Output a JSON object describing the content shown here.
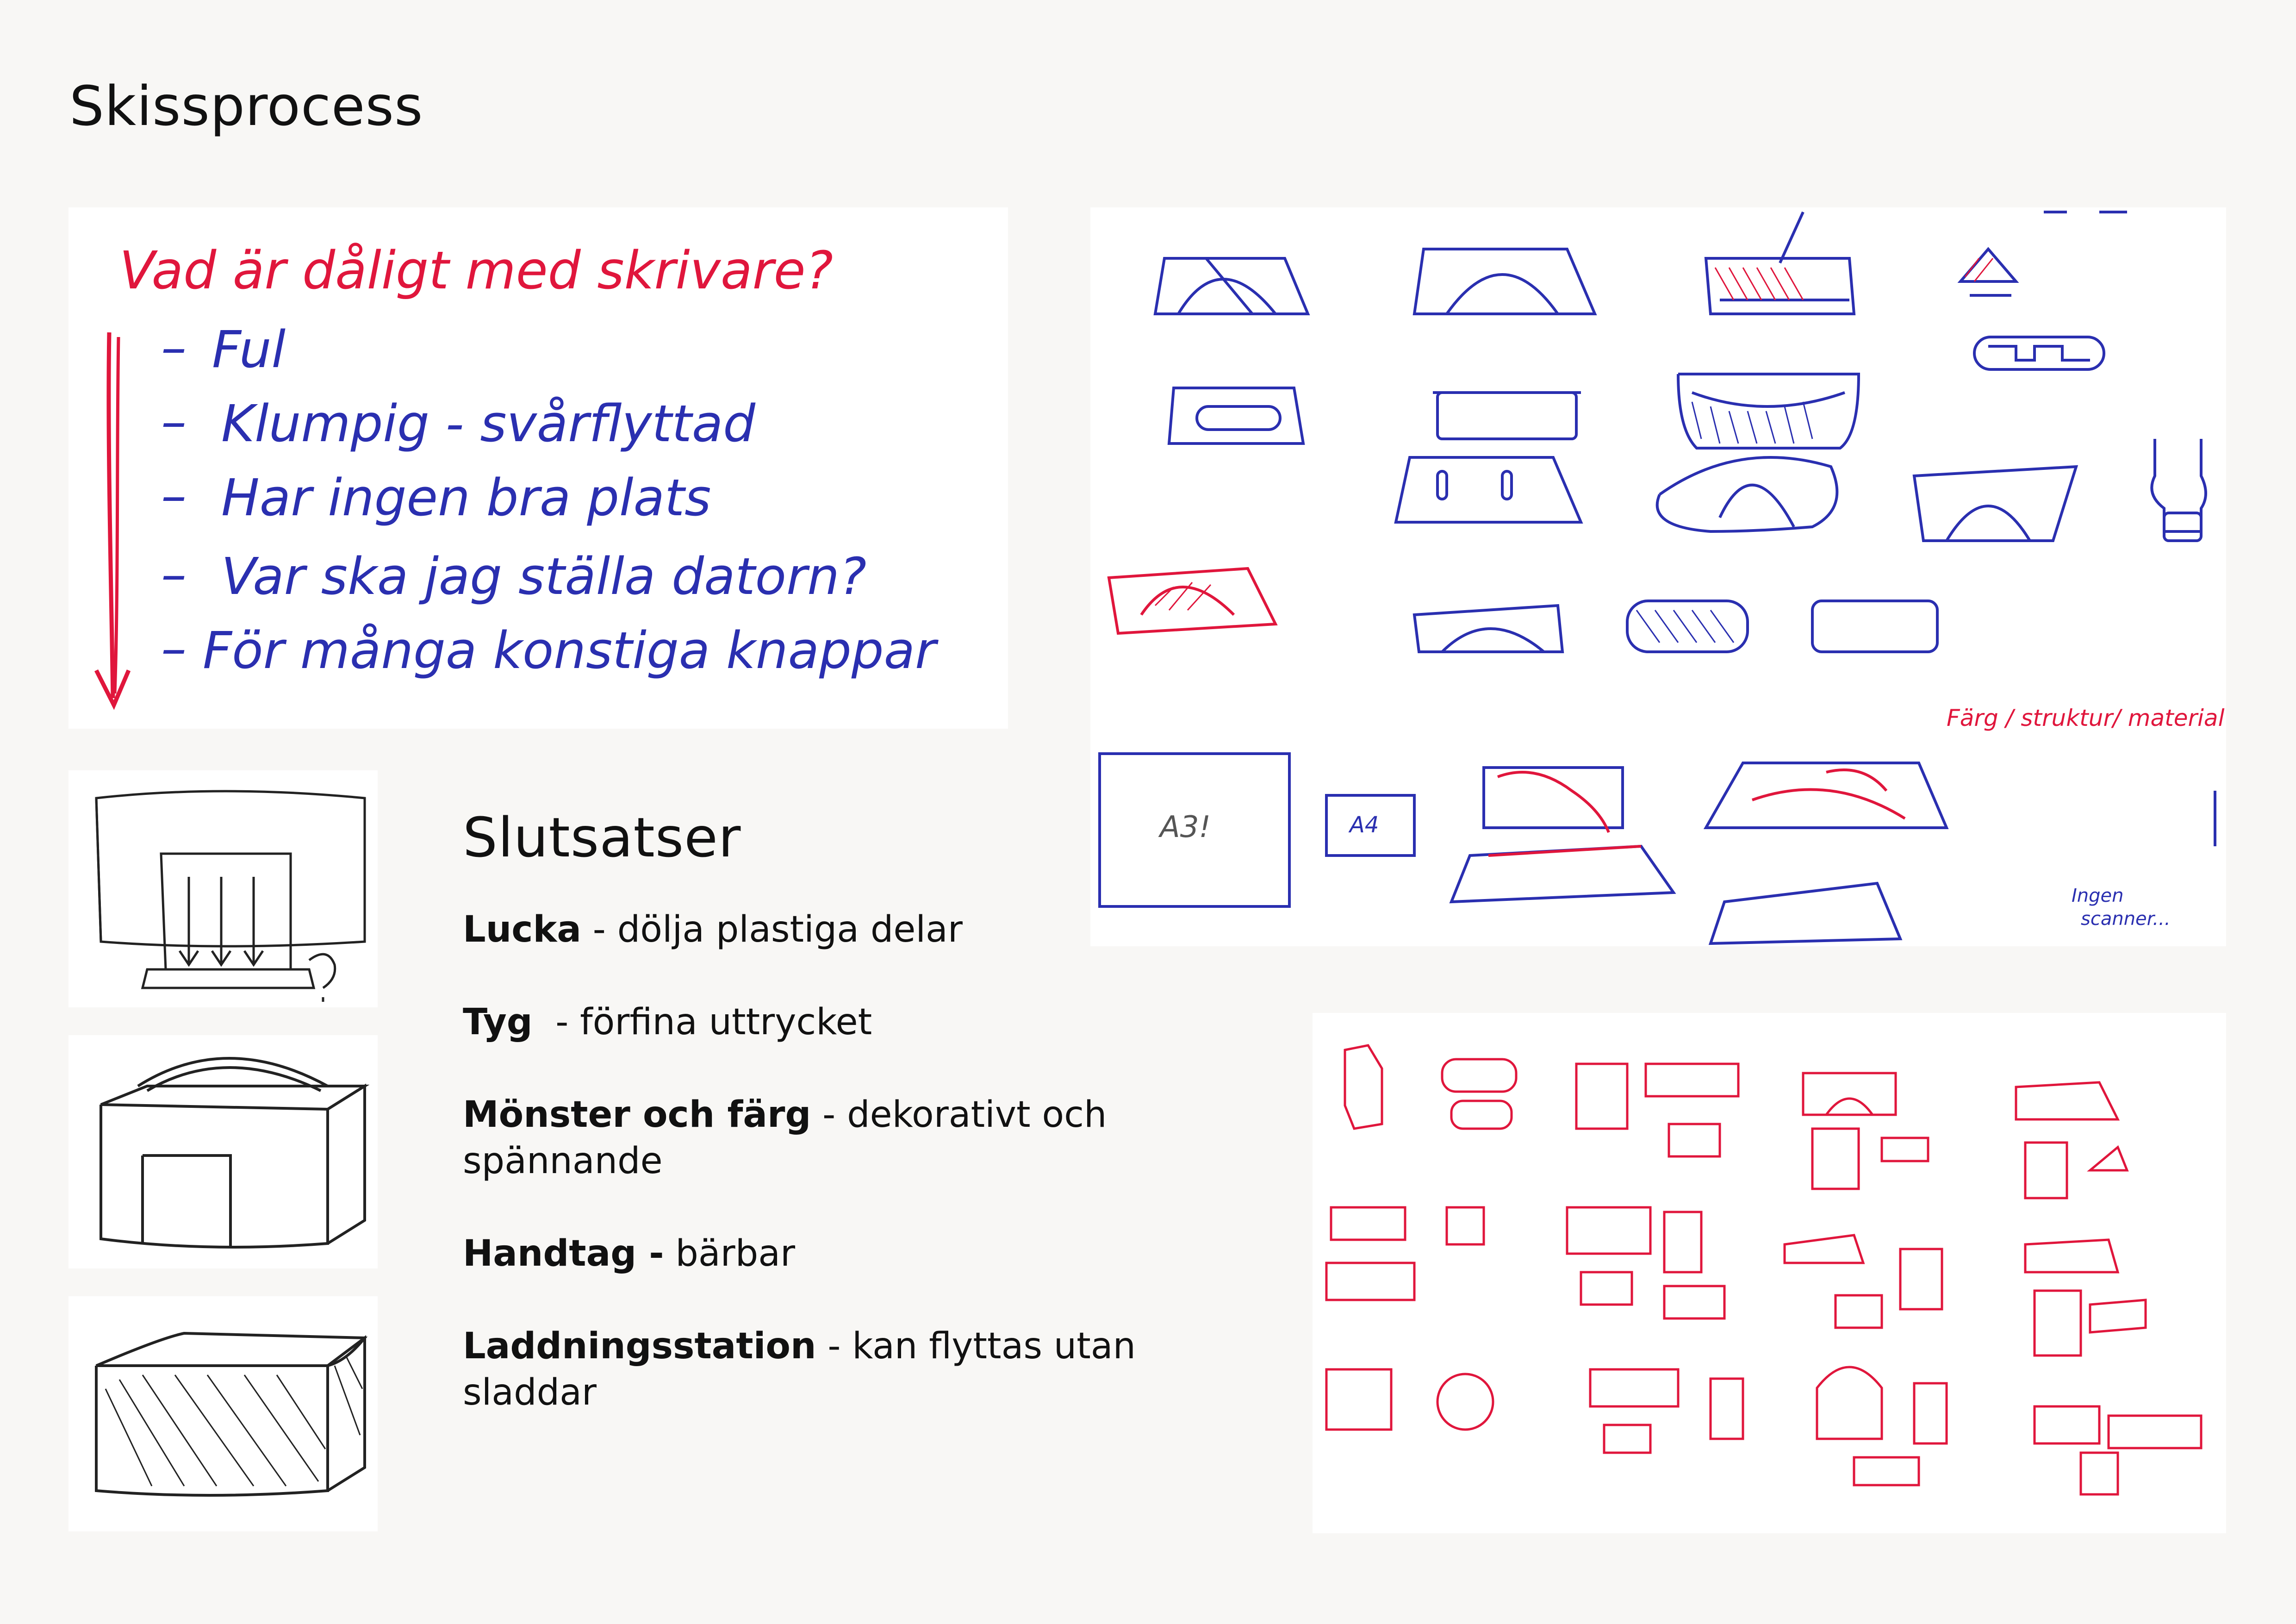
{
  "page": {
    "title": "Skissprocess"
  },
  "notes": {
    "question": "Vad är dåligt med skrivare?",
    "points": [
      "Ful",
      "Klumpig - svårflyttad",
      "Har ingen bra plats",
      "Var ska jag ställa datorn?",
      "För många konstiga knappar"
    ]
  },
  "sketch_labels": {
    "a3": "A3!",
    "a4": "A4",
    "material": "Färg / struktur/ material?",
    "scanner_line1": "Ingen",
    "scanner_line2": "scanner..."
  },
  "summary": {
    "heading": "Slutsatser",
    "items": [
      {
        "term": "Lucka",
        "desc": " - dölja plastiga delar"
      },
      {
        "term": "Tyg",
        "desc": "  - förfina uttrycket"
      },
      {
        "term": "Mönster och färg",
        "desc": " - dekorativt och spännande"
      },
      {
        "term": "Handtag -",
        "desc": " bärbar"
      },
      {
        "term": "Laddningsstation",
        "desc": " - kan flyttas utan sladdar"
      }
    ]
  },
  "colors": {
    "background": "#f8f7f5",
    "ink_red": "#e0163c",
    "ink_blue": "#2a2fb0",
    "ink_black": "#222222"
  }
}
